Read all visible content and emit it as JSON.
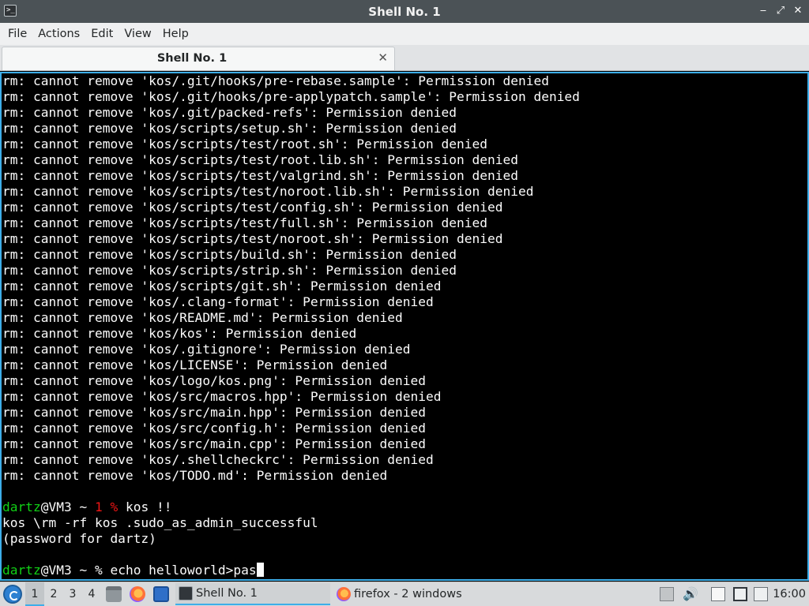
{
  "window": {
    "title": "Shell No. 1",
    "app_icon": "terminal-icon",
    "buttons": [
      "minimize",
      "maximize",
      "close"
    ]
  },
  "menubar": {
    "items": [
      "File",
      "Actions",
      "Edit",
      "View",
      "Help"
    ]
  },
  "tabs": [
    {
      "label": "Shell No. 1",
      "active": true
    }
  ],
  "terminal": {
    "lines": [
      "rm: cannot remove 'kos/.git/hooks/pre-rebase.sample': Permission denied",
      "rm: cannot remove 'kos/.git/hooks/pre-applypatch.sample': Permission denied",
      "rm: cannot remove 'kos/.git/packed-refs': Permission denied",
      "rm: cannot remove 'kos/scripts/setup.sh': Permission denied",
      "rm: cannot remove 'kos/scripts/test/root.sh': Permission denied",
      "rm: cannot remove 'kos/scripts/test/root.lib.sh': Permission denied",
      "rm: cannot remove 'kos/scripts/test/valgrind.sh': Permission denied",
      "rm: cannot remove 'kos/scripts/test/noroot.lib.sh': Permission denied",
      "rm: cannot remove 'kos/scripts/test/config.sh': Permission denied",
      "rm: cannot remove 'kos/scripts/test/full.sh': Permission denied",
      "rm: cannot remove 'kos/scripts/test/noroot.sh': Permission denied",
      "rm: cannot remove 'kos/scripts/build.sh': Permission denied",
      "rm: cannot remove 'kos/scripts/strip.sh': Permission denied",
      "rm: cannot remove 'kos/scripts/git.sh': Permission denied",
      "rm: cannot remove 'kos/.clang-format': Permission denied",
      "rm: cannot remove 'kos/README.md': Permission denied",
      "rm: cannot remove 'kos/kos': Permission denied",
      "rm: cannot remove 'kos/.gitignore': Permission denied",
      "rm: cannot remove 'kos/LICENSE': Permission denied",
      "rm: cannot remove 'kos/logo/kos.png': Permission denied",
      "rm: cannot remove 'kos/src/macros.hpp': Permission denied",
      "rm: cannot remove 'kos/src/main.hpp': Permission denied",
      "rm: cannot remove 'kos/src/config.h': Permission denied",
      "rm: cannot remove 'kos/src/main.cpp': Permission denied",
      "rm: cannot remove 'kos/.shellcheckrc': Permission denied",
      "rm: cannot remove 'kos/TODO.md': Permission denied"
    ],
    "prompt1": {
      "user_host": "dartz",
      "at_host": "@VM3 ~ ",
      "status": "1 %",
      "command": " kos !!"
    },
    "output_after_prompt1": [
      "kos \\rm -rf kos .sudo_as_admin_successful",
      "(password for dartz)"
    ],
    "prompt2": {
      "user_host": "dartz",
      "at_host": "@VM3 ~ % ",
      "command": "echo helloworld>pas"
    },
    "colors": {
      "background": "#000000",
      "foreground": "#fcfcfc",
      "prompt_user": "#11d116",
      "prompt_status": "#ed1515",
      "focus_border": "#3daee9"
    }
  },
  "taskbar": {
    "start_icon": "app-launcher-icon",
    "desktops": [
      "1",
      "2",
      "3",
      "4"
    ],
    "active_desktop": "1",
    "quick_launch": [
      "file-manager-icon",
      "firefox-icon",
      "show-desktop-icon"
    ],
    "tasks": [
      {
        "label": "Shell No. 1",
        "icon": "terminal-icon",
        "active": true
      },
      {
        "label": "firefox - 2 windows",
        "icon": "firefox-icon",
        "active": false
      }
    ],
    "tray": [
      "notification-icon",
      "volume-icon",
      "clipboard-icon",
      "network-icon"
    ],
    "clock": "16:00"
  }
}
